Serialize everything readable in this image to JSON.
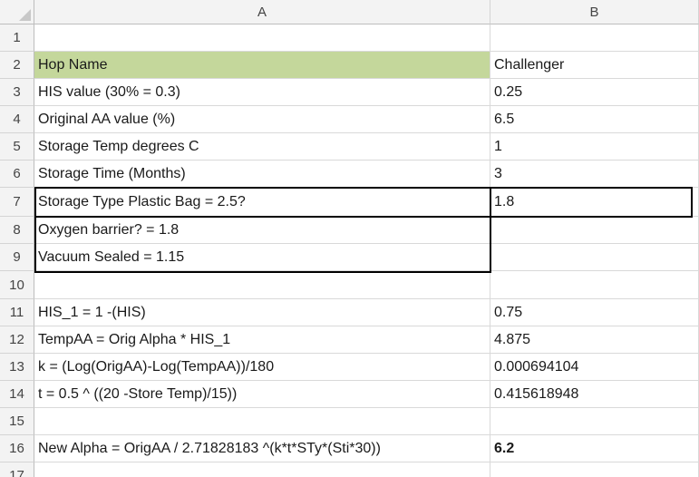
{
  "columns": {
    "a": "A",
    "b": "B"
  },
  "rows": [
    {
      "num": "1",
      "a": "",
      "b": ""
    },
    {
      "num": "2",
      "a": "Hop Name",
      "b": "Challenger"
    },
    {
      "num": "3",
      "a": "HIS value  (30% = 0.3)",
      "b": "0.25"
    },
    {
      "num": "4",
      "a": "Original AA value (%)",
      "b": "6.5"
    },
    {
      "num": "5",
      "a": "Storage Temp  degrees C",
      "b": "1"
    },
    {
      "num": "6",
      "a": "Storage Time  (Months)",
      "b": "3"
    },
    {
      "num": "7",
      "a": "Storage Type   Plastic Bag = 2.5?",
      "b": "1.8"
    },
    {
      "num": "8",
      "a": "Oxygen barrier? = 1.8",
      "b": ""
    },
    {
      "num": "9",
      "a": "Vacuum Sealed = 1.15",
      "b": ""
    },
    {
      "num": "10",
      "a": "",
      "b": ""
    },
    {
      "num": "11",
      "a": "HIS_1 = 1 -(HIS)",
      "b": "0.75"
    },
    {
      "num": "12",
      "a": "TempAA  = Orig Alpha * HIS_1",
      "b": "4.875"
    },
    {
      "num": "13",
      "a": "k = (Log(OrigAA)-Log(TempAA))/180",
      "b": "0.000694104"
    },
    {
      "num": "14",
      "a": "t = 0.5 ^ ((20 -Store Temp)/15))",
      "b": "0.415618948"
    },
    {
      "num": "15",
      "a": "",
      "b": ""
    },
    {
      "num": "16",
      "a": "New Alpha = OrigAA / 2.71828183 ^(k*t*STy*(Sti*30))",
      "b": "6.2"
    },
    {
      "num": "17",
      "a": "",
      "b": ""
    }
  ],
  "colors": {
    "header_fill": "#c4d79b",
    "grid": "#d9d9d9",
    "header_bg": "#f3f3f3"
  }
}
